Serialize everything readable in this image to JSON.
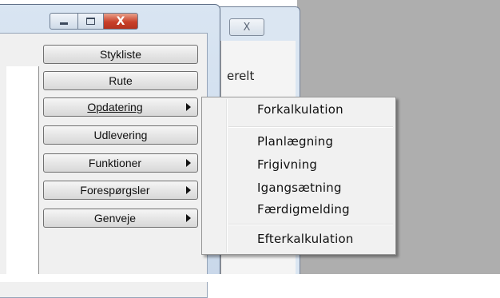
{
  "front_window": {
    "buttons": [
      {
        "label": "Stykliste",
        "submenu": false
      },
      {
        "label": "Rute",
        "submenu": false
      },
      {
        "label": "Opdatering",
        "submenu": true
      },
      {
        "label": "Udlevering",
        "submenu": false
      },
      {
        "label": "Funktioner",
        "submenu": true
      },
      {
        "label": "Forespørgsler",
        "submenu": true
      },
      {
        "label": "Genveje",
        "submenu": true
      }
    ],
    "caption": {
      "minimize_icon": "minimize-icon",
      "maximize_icon": "maximize-icon",
      "close_icon": "close-icon",
      "close_glyph": "X"
    }
  },
  "back_window": {
    "close_glyph": "X",
    "partial_text": "erelt"
  },
  "context_menu": {
    "items": [
      "Forkalkulation",
      "Planlægning",
      "Frigivning",
      "Igangsætning",
      "Færdigmelding",
      "Efterkalkulation"
    ]
  },
  "colors": {
    "close_button": "#c8402a",
    "desktop": "#aeaeae"
  }
}
